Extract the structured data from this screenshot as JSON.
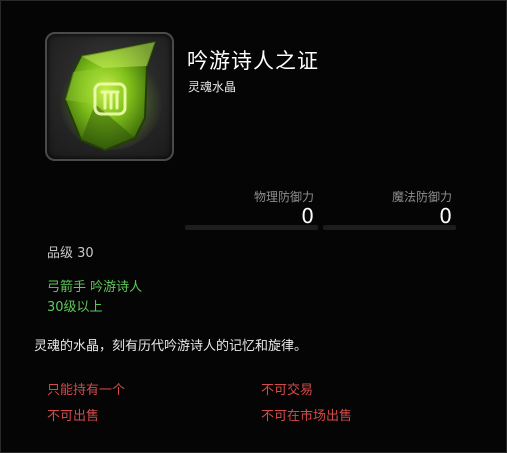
{
  "item": {
    "name": "吟游诗人之证",
    "type": "灵魂水晶",
    "icon": "green-soul-crystal-icon",
    "icon_color": "#7fbf1a"
  },
  "stats": {
    "physical_defense": {
      "label": "物理防御力",
      "value": "0"
    },
    "magic_defense": {
      "label": "魔法防御力",
      "value": "0"
    }
  },
  "grade": "品级 30",
  "requirements": {
    "class": "弓箭手 吟游诗人",
    "level": "30级以上",
    "color": "#5ec85a"
  },
  "description": "灵魂的水晶，刻有历代吟游诗人的记忆和旋律。",
  "restrictions": {
    "unique": "只能持有一个",
    "no_trade": "不可交易",
    "no_sell": "不可出售",
    "no_market": "不可在市场出售",
    "color": "#d24a4a"
  }
}
